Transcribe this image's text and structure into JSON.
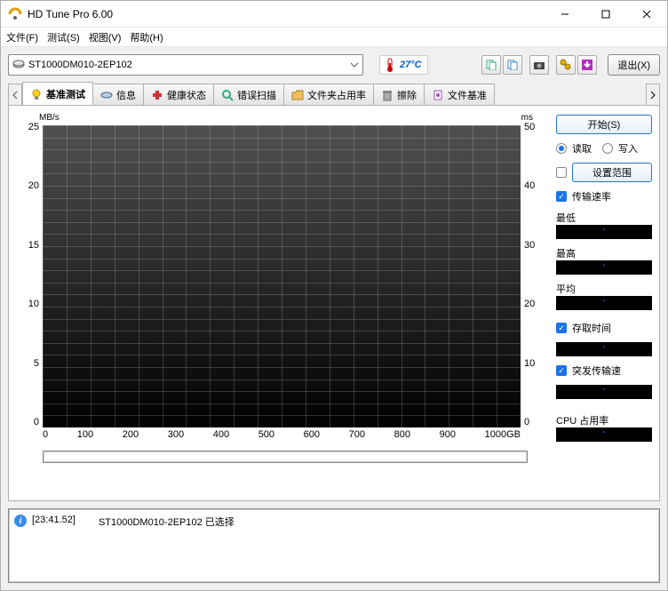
{
  "window": {
    "title": "HD Tune Pro 6.00"
  },
  "menu": {
    "file": "文件(F)",
    "test": "测试(S)",
    "view": "视图(V)",
    "help": "帮助(H)"
  },
  "toolbar": {
    "drive": "ST1000DM010-2EP102",
    "temperature": "27°C",
    "exit": "退出(X)"
  },
  "tabs": {
    "benchmark": "基准测试",
    "info": "信息",
    "health": "健康状态",
    "errorscan": "错误扫描",
    "folderusage": "文件夹占用率",
    "erase": "擦除",
    "filebench": "文件基准"
  },
  "chart": {
    "y_left_unit": "MB/s",
    "y_right_unit": "ms",
    "x_unit": "GB"
  },
  "chart_data": {
    "type": "line",
    "title": "",
    "x_range": [
      0,
      1000
    ],
    "x_ticks": [
      0,
      100,
      200,
      300,
      400,
      500,
      600,
      700,
      800,
      900,
      1000
    ],
    "x_unit": "GB",
    "y_left": {
      "label": "MB/s",
      "range": [
        0,
        25
      ],
      "ticks": [
        0,
        5,
        10,
        15,
        20,
        25
      ]
    },
    "y_right": {
      "label": "ms",
      "range": [
        0,
        50
      ],
      "ticks": [
        0,
        10,
        20,
        30,
        40,
        50
      ]
    },
    "series": []
  },
  "controls": {
    "start": "开始(S)",
    "read": "读取",
    "write": "写入",
    "set_range": "设置范围",
    "transfer_rate": "传输速率",
    "min": "最低",
    "max": "最高",
    "avg": "平均",
    "access_time": "存取时间",
    "burst_rate": "突发传输速",
    "cpu_usage": "CPU 占用率"
  },
  "log": {
    "time": "[23:41.52]",
    "msg": "ST1000DM010-2EP102 已选择"
  }
}
